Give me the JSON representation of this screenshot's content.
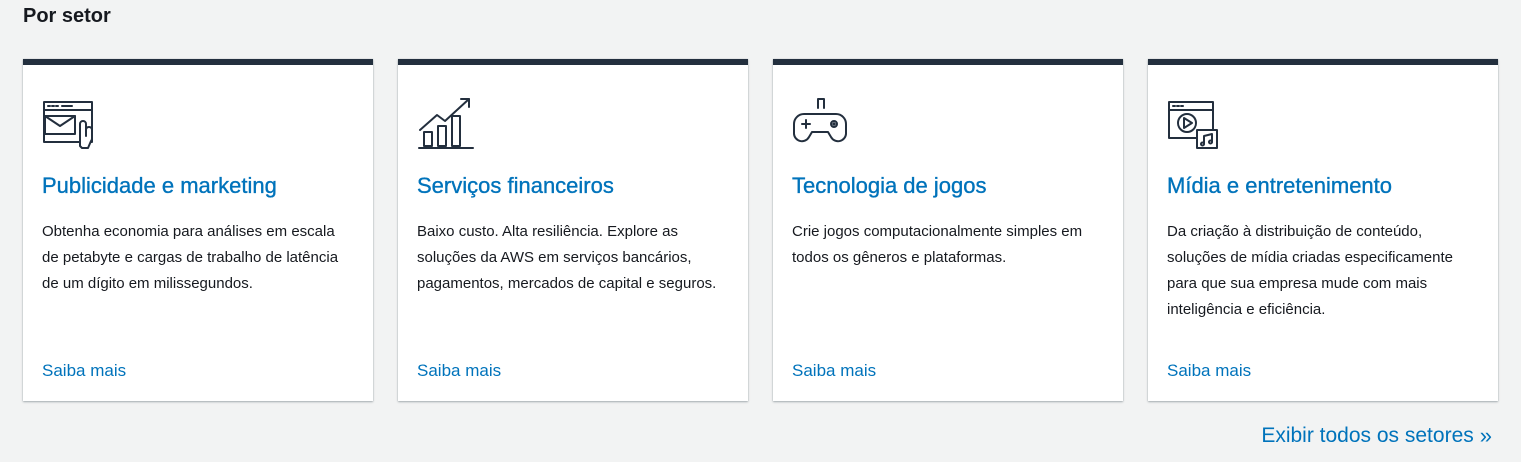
{
  "section": {
    "title": "Por setor"
  },
  "cards": [
    {
      "icon": "email-browser-icon",
      "title": "Publicidade e marketing",
      "description": "Obtenha economia para análises em escala de petabyte e cargas de trabalho de latência de um dígito em milissegundos.",
      "link": "Saiba mais"
    },
    {
      "icon": "growth-chart-icon",
      "title": "Serviços financeiros",
      "description": "Baixo custo. Alta resiliência. Explore as soluções da AWS em serviços bancários, pagamentos, mercados de capital e seguros.",
      "link": "Saiba mais"
    },
    {
      "icon": "gamepad-icon",
      "title": "Tecnologia de jogos",
      "description": "Crie jogos computacionalmente simples em todos os gêneros e plataformas.",
      "link": "Saiba mais"
    },
    {
      "icon": "media-player-icon",
      "title": "Mídia e entretenimento",
      "description": "Da criação à distribuição de conteúdo, soluções de mídia criadas especificamente para que sua empresa mude com mais inteligência e eficiência.",
      "link": "Saiba mais"
    }
  ],
  "footer": {
    "view_all": "Exibir todos os setores",
    "view_all_icon": "double-chevron-right-icon"
  },
  "colors": {
    "accent": "#0073bb",
    "card_border": "#232f3e",
    "background": "#f2f3f3"
  }
}
